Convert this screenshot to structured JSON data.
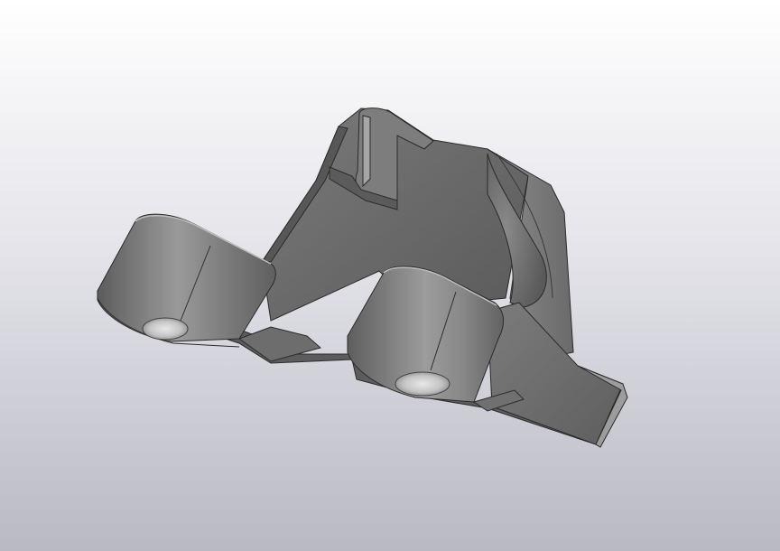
{
  "viewport": {
    "background_top": "#ffffff",
    "background_bottom": "#b9b9c4"
  },
  "model": {
    "body_color": "#6b6b6b",
    "edge_color": "#2b2b2b",
    "highlight_color": "#a8a8a8",
    "shadow_color": "#4a4a4a"
  }
}
